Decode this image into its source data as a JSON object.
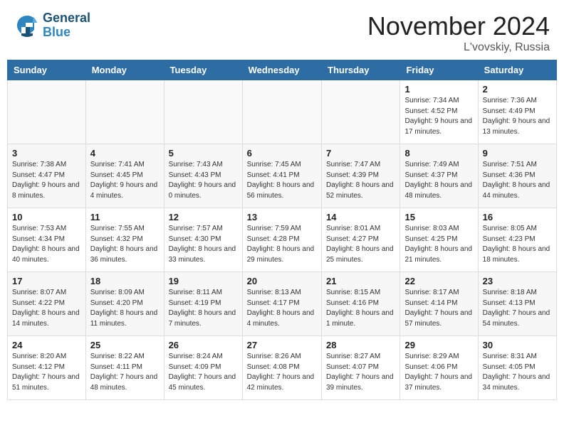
{
  "header": {
    "logo_line1": "General",
    "logo_line2": "Blue",
    "month": "November 2024",
    "location": "L'vovskiy, Russia"
  },
  "days_of_week": [
    "Sunday",
    "Monday",
    "Tuesday",
    "Wednesday",
    "Thursday",
    "Friday",
    "Saturday"
  ],
  "weeks": [
    [
      {
        "day": "",
        "info": ""
      },
      {
        "day": "",
        "info": ""
      },
      {
        "day": "",
        "info": ""
      },
      {
        "day": "",
        "info": ""
      },
      {
        "day": "",
        "info": ""
      },
      {
        "day": "1",
        "info": "Sunrise: 7:34 AM\nSunset: 4:52 PM\nDaylight: 9 hours and 17 minutes."
      },
      {
        "day": "2",
        "info": "Sunrise: 7:36 AM\nSunset: 4:49 PM\nDaylight: 9 hours and 13 minutes."
      }
    ],
    [
      {
        "day": "3",
        "info": "Sunrise: 7:38 AM\nSunset: 4:47 PM\nDaylight: 9 hours and 8 minutes."
      },
      {
        "day": "4",
        "info": "Sunrise: 7:41 AM\nSunset: 4:45 PM\nDaylight: 9 hours and 4 minutes."
      },
      {
        "day": "5",
        "info": "Sunrise: 7:43 AM\nSunset: 4:43 PM\nDaylight: 9 hours and 0 minutes."
      },
      {
        "day": "6",
        "info": "Sunrise: 7:45 AM\nSunset: 4:41 PM\nDaylight: 8 hours and 56 minutes."
      },
      {
        "day": "7",
        "info": "Sunrise: 7:47 AM\nSunset: 4:39 PM\nDaylight: 8 hours and 52 minutes."
      },
      {
        "day": "8",
        "info": "Sunrise: 7:49 AM\nSunset: 4:37 PM\nDaylight: 8 hours and 48 minutes."
      },
      {
        "day": "9",
        "info": "Sunrise: 7:51 AM\nSunset: 4:36 PM\nDaylight: 8 hours and 44 minutes."
      }
    ],
    [
      {
        "day": "10",
        "info": "Sunrise: 7:53 AM\nSunset: 4:34 PM\nDaylight: 8 hours and 40 minutes."
      },
      {
        "day": "11",
        "info": "Sunrise: 7:55 AM\nSunset: 4:32 PM\nDaylight: 8 hours and 36 minutes."
      },
      {
        "day": "12",
        "info": "Sunrise: 7:57 AM\nSunset: 4:30 PM\nDaylight: 8 hours and 33 minutes."
      },
      {
        "day": "13",
        "info": "Sunrise: 7:59 AM\nSunset: 4:28 PM\nDaylight: 8 hours and 29 minutes."
      },
      {
        "day": "14",
        "info": "Sunrise: 8:01 AM\nSunset: 4:27 PM\nDaylight: 8 hours and 25 minutes."
      },
      {
        "day": "15",
        "info": "Sunrise: 8:03 AM\nSunset: 4:25 PM\nDaylight: 8 hours and 21 minutes."
      },
      {
        "day": "16",
        "info": "Sunrise: 8:05 AM\nSunset: 4:23 PM\nDaylight: 8 hours and 18 minutes."
      }
    ],
    [
      {
        "day": "17",
        "info": "Sunrise: 8:07 AM\nSunset: 4:22 PM\nDaylight: 8 hours and 14 minutes."
      },
      {
        "day": "18",
        "info": "Sunrise: 8:09 AM\nSunset: 4:20 PM\nDaylight: 8 hours and 11 minutes."
      },
      {
        "day": "19",
        "info": "Sunrise: 8:11 AM\nSunset: 4:19 PM\nDaylight: 8 hours and 7 minutes."
      },
      {
        "day": "20",
        "info": "Sunrise: 8:13 AM\nSunset: 4:17 PM\nDaylight: 8 hours and 4 minutes."
      },
      {
        "day": "21",
        "info": "Sunrise: 8:15 AM\nSunset: 4:16 PM\nDaylight: 8 hours and 1 minute."
      },
      {
        "day": "22",
        "info": "Sunrise: 8:17 AM\nSunset: 4:14 PM\nDaylight: 7 hours and 57 minutes."
      },
      {
        "day": "23",
        "info": "Sunrise: 8:18 AM\nSunset: 4:13 PM\nDaylight: 7 hours and 54 minutes."
      }
    ],
    [
      {
        "day": "24",
        "info": "Sunrise: 8:20 AM\nSunset: 4:12 PM\nDaylight: 7 hours and 51 minutes."
      },
      {
        "day": "25",
        "info": "Sunrise: 8:22 AM\nSunset: 4:11 PM\nDaylight: 7 hours and 48 minutes."
      },
      {
        "day": "26",
        "info": "Sunrise: 8:24 AM\nSunset: 4:09 PM\nDaylight: 7 hours and 45 minutes."
      },
      {
        "day": "27",
        "info": "Sunrise: 8:26 AM\nSunset: 4:08 PM\nDaylight: 7 hours and 42 minutes."
      },
      {
        "day": "28",
        "info": "Sunrise: 8:27 AM\nSunset: 4:07 PM\nDaylight: 7 hours and 39 minutes."
      },
      {
        "day": "29",
        "info": "Sunrise: 8:29 AM\nSunset: 4:06 PM\nDaylight: 7 hours and 37 minutes."
      },
      {
        "day": "30",
        "info": "Sunrise: 8:31 AM\nSunset: 4:05 PM\nDaylight: 7 hours and 34 minutes."
      }
    ]
  ]
}
